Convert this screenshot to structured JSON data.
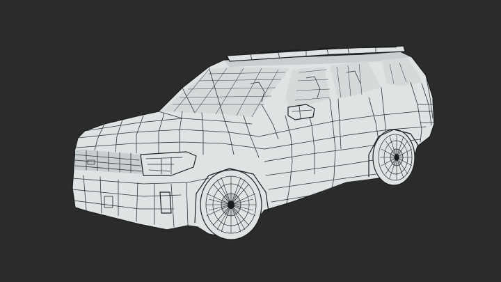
{
  "scene": {
    "subject": "suv-wireframe-model",
    "colors": {
      "background": "#2b2b2b",
      "surface": "#dfe3e4",
      "surface_shade": "#c9ced0",
      "wire": "#2e3336"
    }
  }
}
